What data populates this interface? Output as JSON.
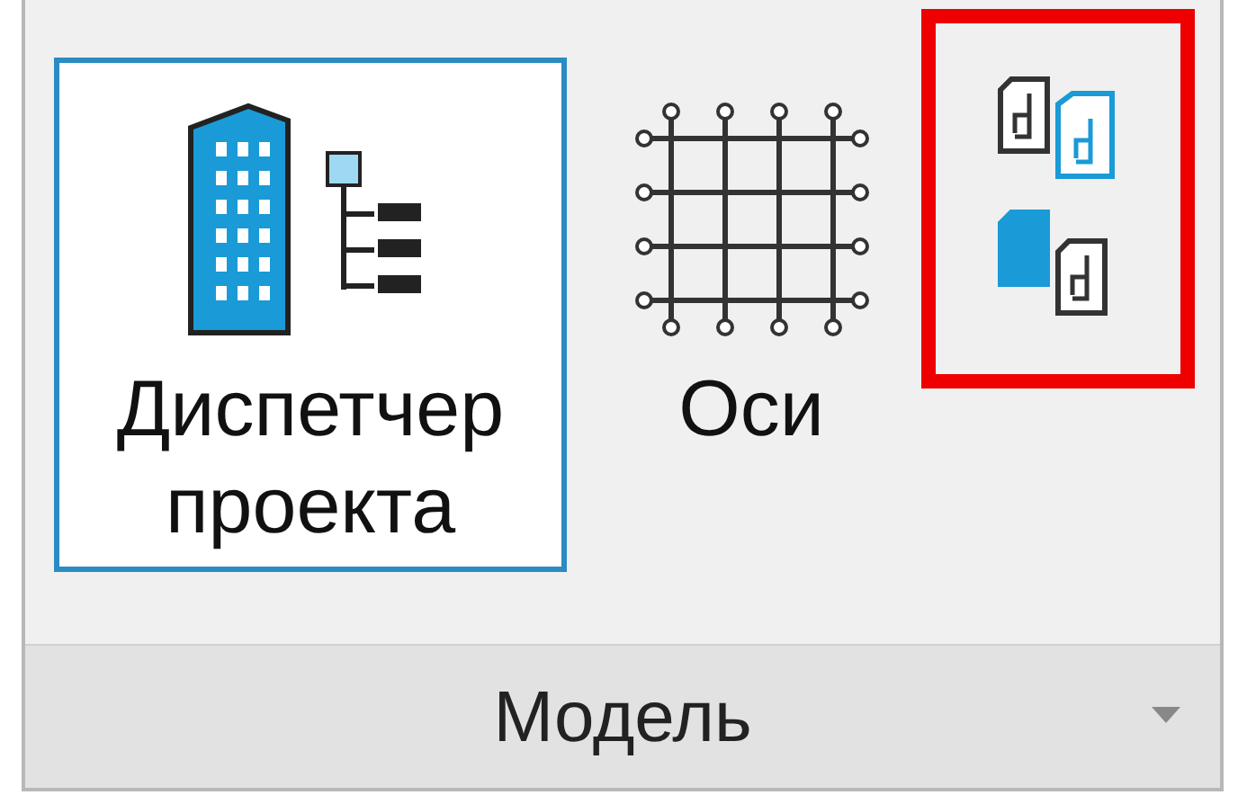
{
  "panel": {
    "title": "Модель",
    "has_menu": true
  },
  "large_buttons": [
    {
      "label": "Диспетчер проекта",
      "kind": "manager",
      "selected": true
    },
    {
      "label": "Оси",
      "kind": "grid",
      "selected": false
    }
  ],
  "small_buttons": {
    "highlighted": true,
    "items": [
      {
        "kind": "copy-to"
      },
      {
        "kind": "copy-from"
      }
    ]
  }
}
